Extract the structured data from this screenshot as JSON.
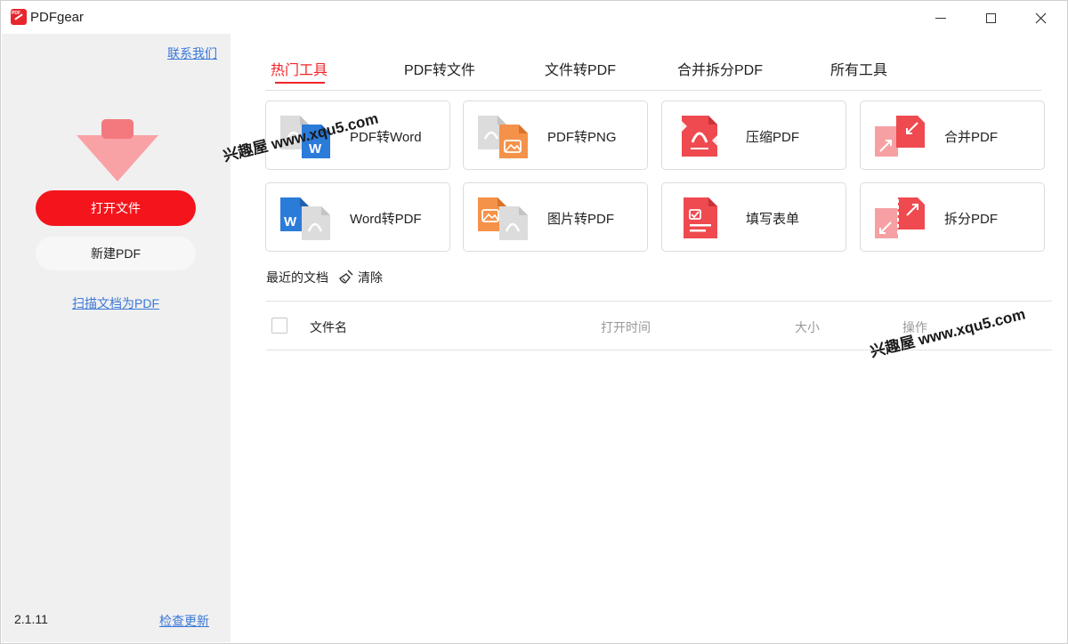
{
  "window": {
    "title": "PDFgear",
    "logo_text": "PDF"
  },
  "sidebar": {
    "contact_label": "联系我们",
    "open_file_label": "打开文件",
    "new_pdf_label": "新建PDF",
    "scan_label": "扫描文档为PDF",
    "version": "2.1.11",
    "update_label": "检查更新"
  },
  "tabs": [
    {
      "label": "热门工具",
      "active": true
    },
    {
      "label": "PDF转文件",
      "active": false
    },
    {
      "label": "文件转PDF",
      "active": false
    },
    {
      "label": "合并拆分PDF",
      "active": false
    },
    {
      "label": "所有工具",
      "active": false
    }
  ],
  "tools": [
    {
      "label": "PDF转Word",
      "icon": "pdf-to-word-icon"
    },
    {
      "label": "PDF转PNG",
      "icon": "pdf-to-png-icon"
    },
    {
      "label": "压缩PDF",
      "icon": "compress-pdf-icon"
    },
    {
      "label": "合并PDF",
      "icon": "merge-pdf-icon"
    },
    {
      "label": "Word转PDF",
      "icon": "word-to-pdf-icon"
    },
    {
      "label": "图片转PDF",
      "icon": "image-to-pdf-icon"
    },
    {
      "label": "填写表单",
      "icon": "fill-form-icon"
    },
    {
      "label": "拆分PDF",
      "icon": "split-pdf-icon"
    }
  ],
  "recent": {
    "title": "最近的文档",
    "clear_label": "清除",
    "columns": {
      "name": "文件名",
      "time": "打开时间",
      "size": "大小",
      "ops": "操作"
    }
  },
  "watermark": "兴趣屋 www.xqu5.com",
  "colors": {
    "accent": "#f0252b",
    "primary_button": "#f4141c",
    "link": "#3b78d8",
    "word_blue": "#2b7bd9",
    "png_orange": "#f5924a"
  }
}
